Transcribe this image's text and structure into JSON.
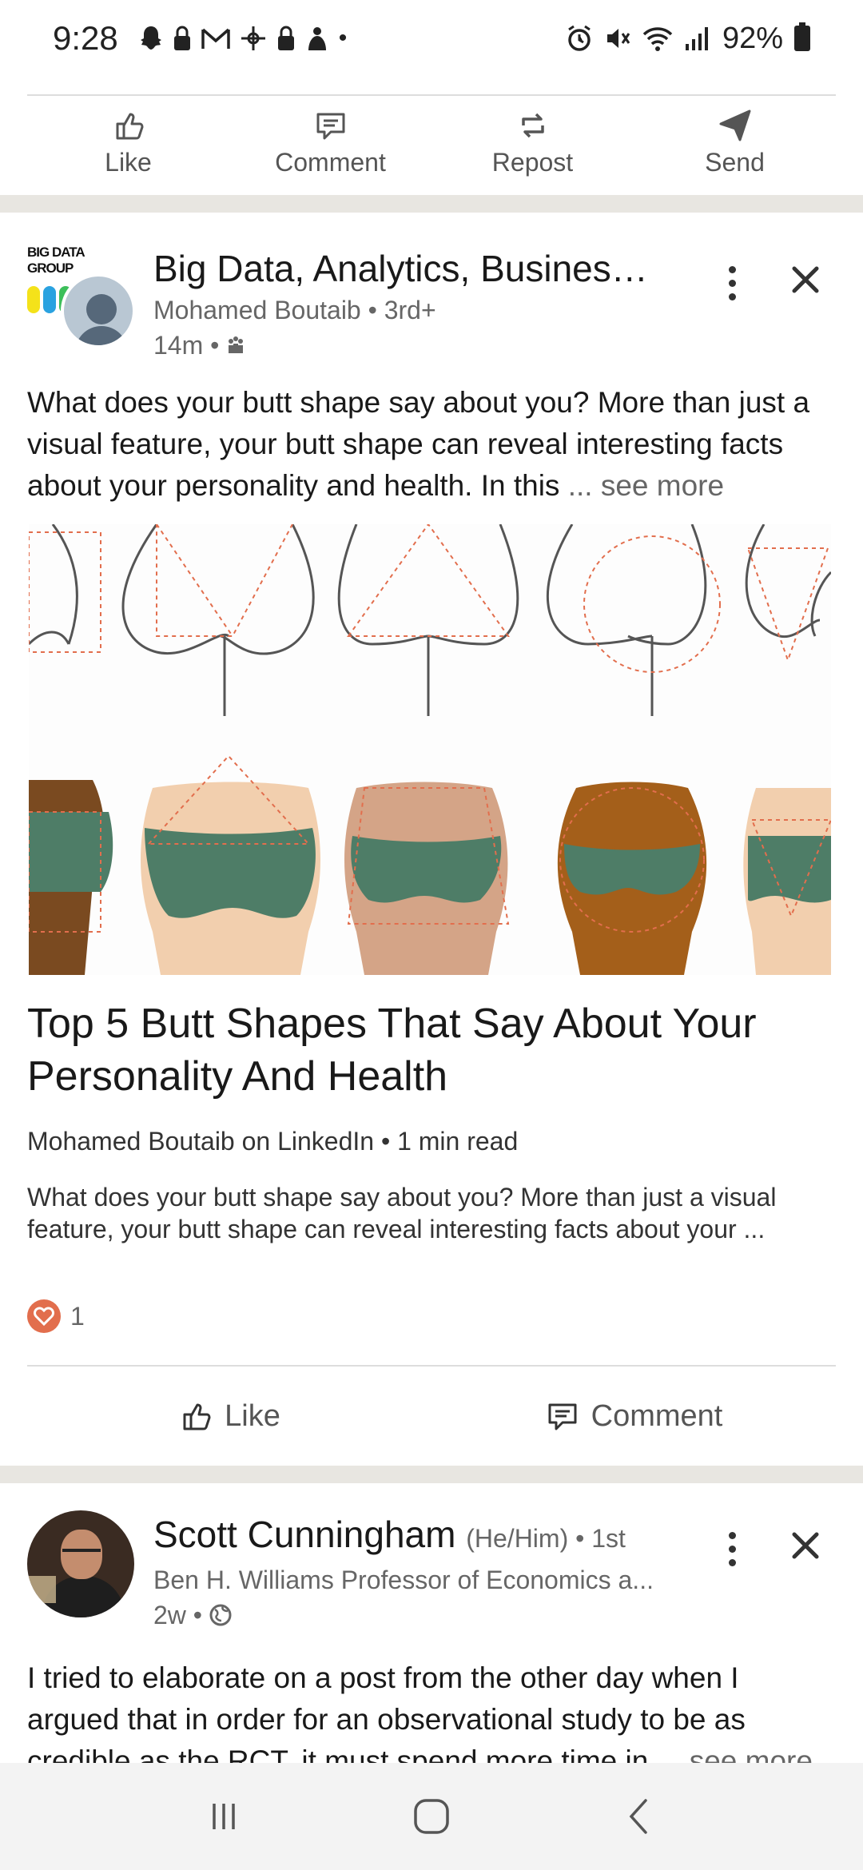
{
  "status_bar": {
    "time": "9:28",
    "battery": "92%"
  },
  "top_actions": [
    {
      "label": "Like",
      "icon": "thumbs-up-icon"
    },
    {
      "label": "Comment",
      "icon": "comment-icon"
    },
    {
      "label": "Repost",
      "icon": "repost-icon"
    },
    {
      "label": "Send",
      "icon": "send-icon"
    }
  ],
  "post1": {
    "page_name": "Big Data, Analytics, Business I...",
    "logo_text": "BIG DATA GROUP",
    "author_line": "Mohamed Boutaib • 3rd+",
    "time": "14m •",
    "text": "What does your butt shape say about you? More than just a visual feature, your butt shape can reveal interesting facts about your personality and health. In this",
    "see_more": "... see more",
    "article_title": "Top 5 Butt Shapes That Say About Your Personality And Health",
    "article_meta": "Mohamed Boutaib on LinkedIn • 1 min read",
    "article_desc": "What does your butt shape say about you? More than just a visual feature, your butt shape can reveal interesting facts about your ...",
    "reaction_count": "1",
    "actions": [
      {
        "label": "Like"
      },
      {
        "label": "Comment"
      }
    ]
  },
  "post2": {
    "name": "Scott Cunningham",
    "pronouns": "(He/Him) • 1st",
    "headline": "Ben H. Williams Professor of Economics a...",
    "time": "2w •",
    "text": "I tried to elaborate on a post from the other day when I argued that in order for an observational study to be as credible as the RCT, it must spend more time in",
    "see_more": "... see more"
  },
  "colors": {
    "accent_orange": "#e26e4d",
    "shorts_green": "#4e7d67",
    "band": "#e8e6e1"
  }
}
